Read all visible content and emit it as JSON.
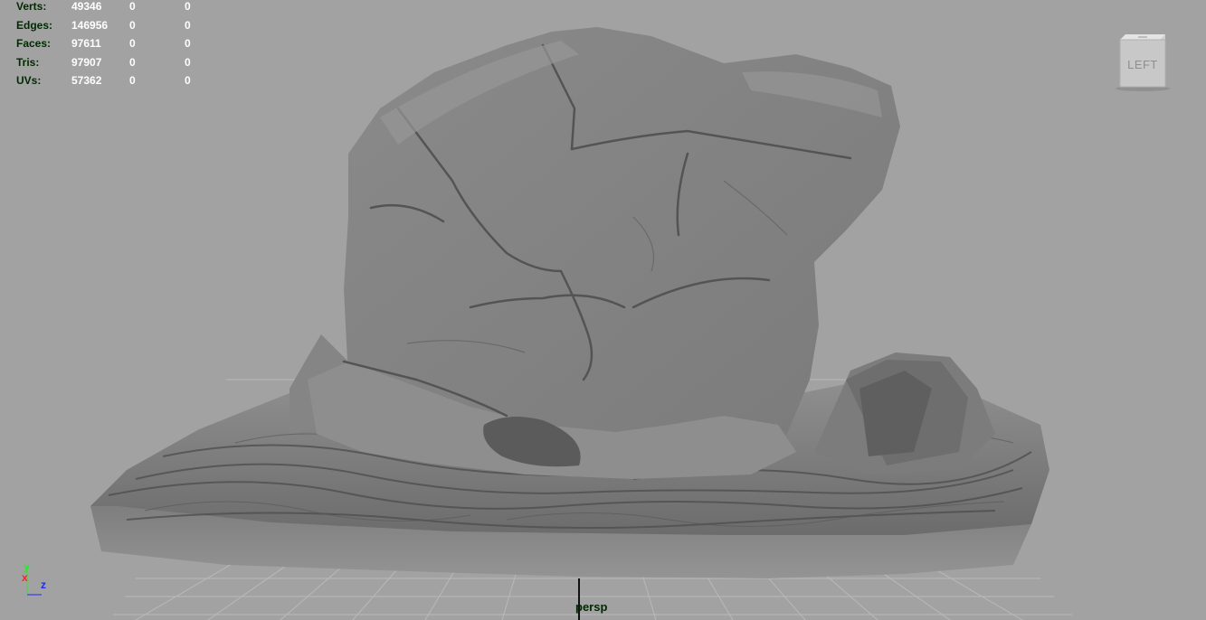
{
  "stats": {
    "rows": [
      {
        "label": "Verts:",
        "c1": "49346",
        "c2": "0",
        "c3": "0"
      },
      {
        "label": "Edges:",
        "c1": "146956",
        "c2": "0",
        "c3": "0"
      },
      {
        "label": "Faces:",
        "c1": "97611",
        "c2": "0",
        "c3": "0"
      },
      {
        "label": "Tris:",
        "c1": "97907",
        "c2": "0",
        "c3": "0"
      },
      {
        "label": "UVs:",
        "c1": "57362",
        "c2": "0",
        "c3": "0"
      }
    ]
  },
  "viewcube": {
    "face_label": "LEFT"
  },
  "axis": {
    "y": "y",
    "x": "x",
    "z": "z"
  },
  "camera": {
    "name": "persp"
  },
  "colors": {
    "background": "#a2a2a2",
    "grid_line": "#b8b8b8",
    "stats_label": "#002a00",
    "stats_value": "#ffffff",
    "axis_x": "#e03030",
    "axis_y": "#34e234",
    "axis_z": "#1a2aff"
  },
  "icons": {
    "viewcube": "viewcube-icon",
    "axis_gizmo": "axis-gizmo-icon"
  }
}
